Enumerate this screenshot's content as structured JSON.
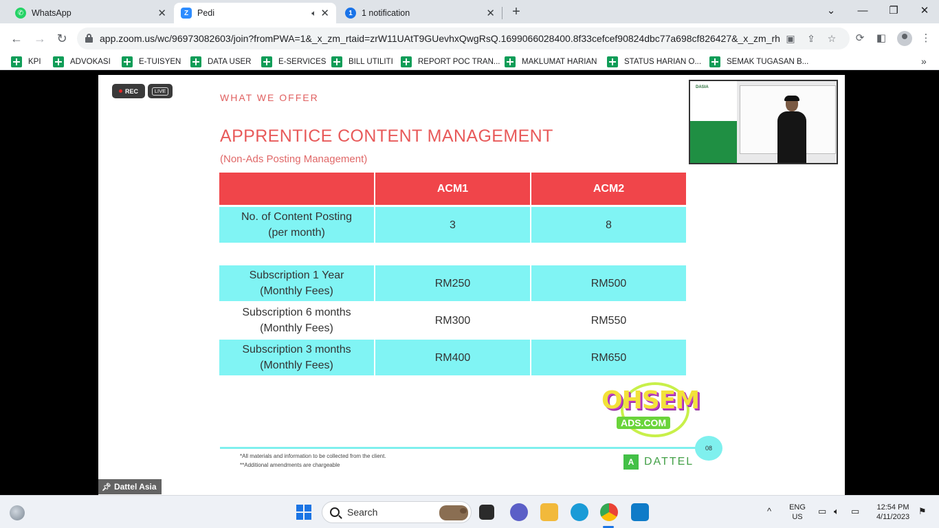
{
  "browser": {
    "tabs": [
      {
        "title": "WhatsApp",
        "icon": "whatsapp-icon"
      },
      {
        "title": "Pedi",
        "icon": "zoom-icon",
        "active": true
      },
      {
        "title": "1 notification",
        "icon": "notification-icon"
      }
    ],
    "url": "app.zoom.us/wc/96973082603/join?fromPWA=1&_x_zm_rtaid=zrW11UAtT9GUevhxQwgRsQ.1699066028400.8f33cefcef90824dbc77a698cf826427&_x_zm_rht...",
    "bookmarks": [
      "KPI",
      "ADVOKASI",
      "E-TUISYEN",
      "DATA USER",
      "E-SERVICES",
      "BILL UTILITI",
      "REPORT POC TRAN...",
      "MAKLUMAT HARIAN",
      "STATUS HARIAN O...",
      "SEMAK TUGASAN B..."
    ]
  },
  "meeting": {
    "rec_label": "REC",
    "live_label": "LIVE",
    "participant_name": "Dattel Asia",
    "speaker_banner_text": "DASIA"
  },
  "slide": {
    "eyebrow": "WHAT WE OFFER",
    "title": "APPRENTICE CONTENT MANAGEMENT",
    "subtitle": "(Non-Ads Posting Management)",
    "table": {
      "headers": [
        "",
        "ACM1",
        "ACM2"
      ],
      "rows": [
        {
          "label_line1": "No. of Content Posting",
          "label_line2": "(per month)",
          "acm1": "3",
          "acm2": "8"
        },
        {
          "label_line1": "Subscription 1 Year",
          "label_line2": "(Monthly Fees)",
          "acm1": "RM250",
          "acm2": "RM500"
        },
        {
          "label_line1": "Subscription 6 months",
          "label_line2": "(Monthly Fees)",
          "acm1": "RM300",
          "acm2": "RM550"
        },
        {
          "label_line1": "Subscription 3 months",
          "label_line2": "(Monthly Fees)",
          "acm1": "RM400",
          "acm2": "RM650"
        }
      ]
    },
    "logo_main": "OHSEM",
    "logo_sub": "ADS.COM",
    "page_number": "08",
    "footnotes": [
      "*All materials and information to be collected from the client.",
      "**Additional amendments are chargeable"
    ],
    "brand_mark": "A",
    "brand": "DATTEL"
  },
  "taskbar": {
    "search_label": "Search",
    "lang_line1": "ENG",
    "lang_line2": "US",
    "time": "12:54 PM",
    "date": "4/11/2023"
  },
  "colors": {
    "header_red": "#f0454a",
    "row_cyan": "#80f4f4",
    "title_red": "#e85a5a",
    "brand_green": "#43c047"
  }
}
